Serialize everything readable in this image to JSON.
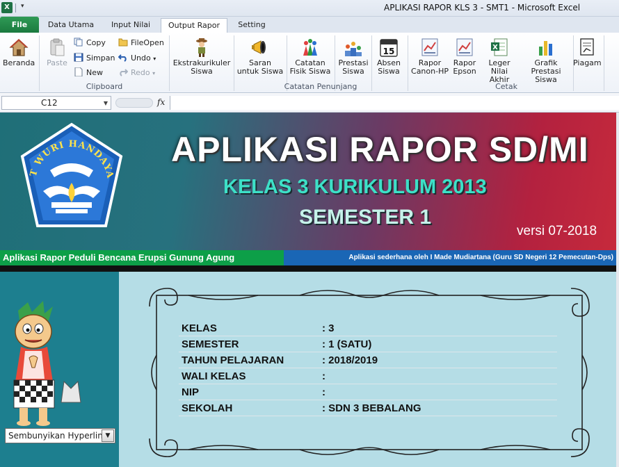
{
  "window": {
    "title": "APLIKASI RAPOR KLS 3 - SMT1  -  Microsoft Excel",
    "app_icon": "X"
  },
  "tabs": [
    {
      "label": "File"
    },
    {
      "label": "Data Utama"
    },
    {
      "label": "Input Nilai"
    },
    {
      "label": "Output Rapor"
    },
    {
      "label": "Setting"
    }
  ],
  "ribbon": {
    "beranda": "Beranda",
    "paste": "Paste",
    "copy": "Copy",
    "simpan": "Simpan",
    "new": "New",
    "fileopen": "FileOpen",
    "undo": "Undo",
    "redo": "Redo",
    "group_clipboard": "Clipboard",
    "ekstra_1": "Ekstrakurikuler",
    "ekstra_2": "Siswa",
    "saran_1": "Saran",
    "saran_2": "untuk Siswa",
    "catatan_1": "Catatan",
    "catatan_2": "Fisik Siswa",
    "prestasi_1": "Prestasi",
    "prestasi_2": "Siswa",
    "absen_1": "Absen",
    "absen_2": "Siswa",
    "group_catatan": "Catatan Penunjang",
    "canon_1": "Rapor",
    "canon_2": "Canon-HP",
    "epson_1": "Rapor",
    "epson_2": "Epson",
    "leger_1": "Leger",
    "leger_2": "Nilai Akhir",
    "grafik_1": "Grafik",
    "grafik_2": "Prestasi Siswa",
    "piagam": "Piagam",
    "group_cetak": "Cetak",
    "calendar_day": "15"
  },
  "formula_bar": {
    "cell_ref": "C12",
    "fx": "fx",
    "content": ""
  },
  "banner": {
    "title": "APLIKASI RAPOR SD/MI",
    "subtitle": "KELAS 3 KURIKULUM 2013",
    "semester": "SEMESTER 1",
    "version": "versi 07-2018",
    "logo_text": "TUT WURI HANDAYANI"
  },
  "strips": {
    "left": "Aplikasi Rapor Peduli Bencana Erupsi Gunung Agung",
    "right": "Aplikasi sederhana oleh I Made Mudiartana (Guru SD Negeri 12 Pemecutan-Dps)"
  },
  "hyperlink_select": {
    "value": "Sembunyikan Hyperlink"
  },
  "info": [
    {
      "label": "KELAS",
      "value": ": 3"
    },
    {
      "label": "SEMESTER",
      "value": ": 1 (SATU)"
    },
    {
      "label": "TAHUN PELAJARAN",
      "value": ": 2018/2019"
    },
    {
      "label": "WALI KELAS",
      "value": ":"
    },
    {
      "label": "NIP",
      "value": ":"
    },
    {
      "label": "SEKOLAH",
      "value": ": SDN 3 BEBALANG"
    }
  ],
  "colors": {
    "file_tab": "#1b7a3f",
    "banner_left": "#1f6f78",
    "banner_right": "#c62a3c",
    "strip_green": "#0d9f48",
    "strip_blue": "#1a66b5",
    "panel_teal": "#1d7f8f",
    "panel_light": "#b5dde6"
  }
}
